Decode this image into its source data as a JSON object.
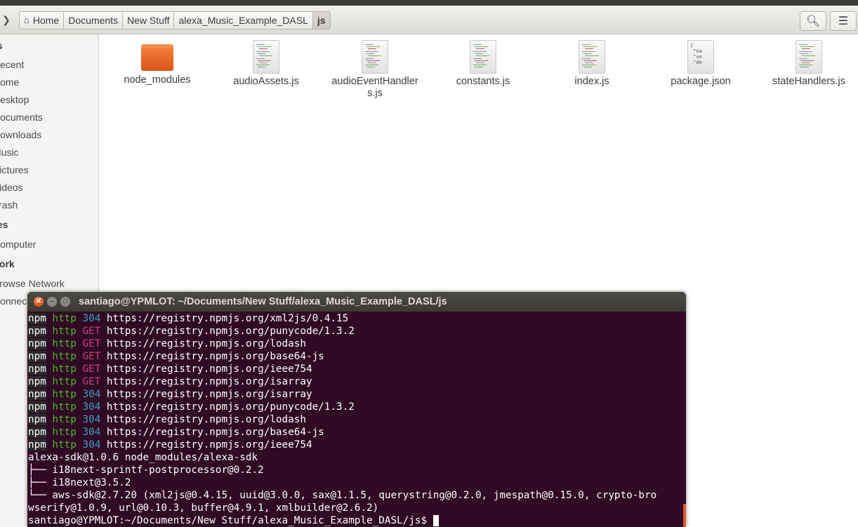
{
  "breadcrumb": [
    "Home",
    "Documents",
    "New Stuff",
    "alexa_Music_Example_DASL",
    "js"
  ],
  "sidebar": [
    {
      "label": "es",
      "type": "head"
    },
    {
      "label": "Recent",
      "type": "item"
    },
    {
      "label": "Home",
      "type": "item"
    },
    {
      "label": "Desktop",
      "type": "item"
    },
    {
      "label": "Documents",
      "type": "item"
    },
    {
      "label": "Downloads",
      "type": "item"
    },
    {
      "label": "Music",
      "type": "item"
    },
    {
      "label": "Pictures",
      "type": "item"
    },
    {
      "label": "Videos",
      "type": "item"
    },
    {
      "label": "Trash",
      "type": "item"
    },
    {
      "label": "ces",
      "type": "head"
    },
    {
      "label": "Computer",
      "type": "item"
    },
    {
      "label": "work",
      "type": "head"
    },
    {
      "label": "Browse Network",
      "type": "item"
    },
    {
      "label": "Connec",
      "type": "item"
    }
  ],
  "files": [
    {
      "name": "node_modules",
      "icon": "folder-icon"
    },
    {
      "name": "audioAssets.js",
      "icon": "js-file-icon"
    },
    {
      "name": "audioEventHandler\ns.js",
      "icon": "js-file-icon"
    },
    {
      "name": "constants.js",
      "icon": "js-file-icon"
    },
    {
      "name": "index.js",
      "icon": "js-file-icon"
    },
    {
      "name": "package.json",
      "icon": "json-file-icon"
    },
    {
      "name": "stateHandlers.js",
      "icon": "js-file-icon"
    }
  ],
  "json_preview": "{\n \"na\n \"ve\n \"de",
  "terminal": {
    "title": "santiago@YPMLOT: ~/Documents/New Stuff/alexa_Music_Example_DASL/js",
    "npm_lines": [
      {
        "method": "304",
        "url": "https://registry.npmjs.org/xml2js/0.4.15"
      },
      {
        "method": "GET",
        "url": "https://registry.npmjs.org/punycode/1.3.2"
      },
      {
        "method": "GET",
        "url": "https://registry.npmjs.org/lodash"
      },
      {
        "method": "GET",
        "url": "https://registry.npmjs.org/base64-js"
      },
      {
        "method": "GET",
        "url": "https://registry.npmjs.org/ieee754"
      },
      {
        "method": "GET",
        "url": "https://registry.npmjs.org/isarray"
      },
      {
        "method": "304",
        "url": "https://registry.npmjs.org/isarray"
      },
      {
        "method": "304",
        "url": "https://registry.npmjs.org/punycode/1.3.2"
      },
      {
        "method": "304",
        "url": "https://registry.npmjs.org/lodash"
      },
      {
        "method": "304",
        "url": "https://registry.npmjs.org/base64-js"
      },
      {
        "method": "304",
        "url": "https://registry.npmjs.org/ieee754"
      }
    ],
    "npm_label": "npm",
    "http_label": "http",
    "tree_lines": [
      "alexa-sdk@1.0.6 node_modules/alexa-sdk",
      "├── i18next-sprintf-postprocessor@0.2.2",
      "├── i18next@3.5.2",
      "└── aws-sdk@2.7.20 (xml2js@0.4.15, uuid@3.0.0, sax@1.1.5, querystring@0.2.0, jmespath@0.15.0, crypto-bro",
      "wserify@1.0.9, url@0.10.3, buffer@4.9.1, xmlbuilder@2.6.2)"
    ],
    "prompt": "santiago@YPMLOT:~/Documents/New Stuff/alexa_Music_Example_DASL/js$ "
  },
  "colors": {
    "terminal_bg": "#300a24",
    "http": "#4fb72b",
    "get": "#c6427b",
    "code304": "#3e9ec4",
    "folder": "#f47c3a"
  }
}
